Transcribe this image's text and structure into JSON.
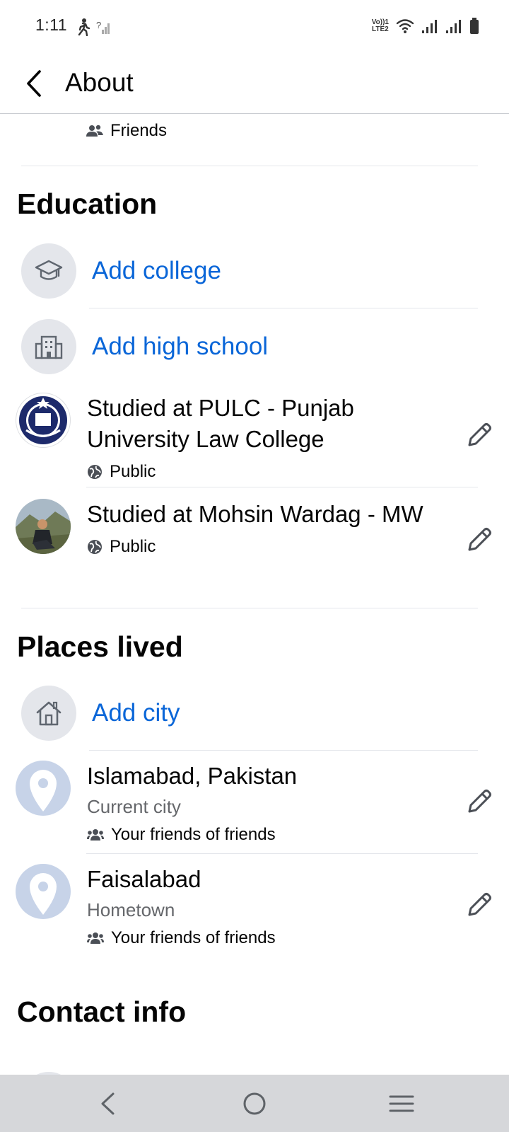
{
  "status_bar": {
    "time": "1:11",
    "volte_line1": "Vo))1",
    "volte_line2": "LTE2"
  },
  "header": {
    "back_icon": "chevron-left-icon",
    "title": "About"
  },
  "top_audience": {
    "icon": "friends-icon",
    "label": "Friends"
  },
  "education": {
    "title": "Education",
    "add_college": {
      "icon": "graduation-cap-icon",
      "label": "Add college"
    },
    "add_high_school": {
      "icon": "school-building-icon",
      "label": "Add high school"
    },
    "entries": [
      {
        "title": "Studied at PULC - Punjab University Law College",
        "audience": "Public",
        "audience_icon": "globe-icon",
        "avatar": "university-seal-logo"
      },
      {
        "title": "Studied at Mohsin Wardag - MW",
        "audience": "Public",
        "audience_icon": "globe-icon",
        "avatar": "profile-photo"
      }
    ]
  },
  "places_lived": {
    "title": "Places lived",
    "add_city": {
      "icon": "home-icon",
      "label": "Add city"
    },
    "entries": [
      {
        "title": "Islamabad, Pakistan",
        "subtitle": "Current city",
        "audience": "Your friends of friends",
        "audience_icon": "friends-of-friends-icon"
      },
      {
        "title": "Faisalabad",
        "subtitle": "Hometown",
        "audience": "Your friends of friends",
        "audience_icon": "friends-of-friends-icon"
      }
    ]
  },
  "contact_info": {
    "title": "Contact info"
  },
  "nav_bar": {
    "back_icon": "nav-back-icon",
    "home_icon": "nav-home-icon",
    "recents_icon": "nav-recents-icon"
  },
  "colors": {
    "accent_blue": "#0a66d8",
    "icon_circle_bg": "#e4e6eb",
    "place_pin_bg": "#c7d3e8",
    "nav_bg": "#d6d7da"
  }
}
